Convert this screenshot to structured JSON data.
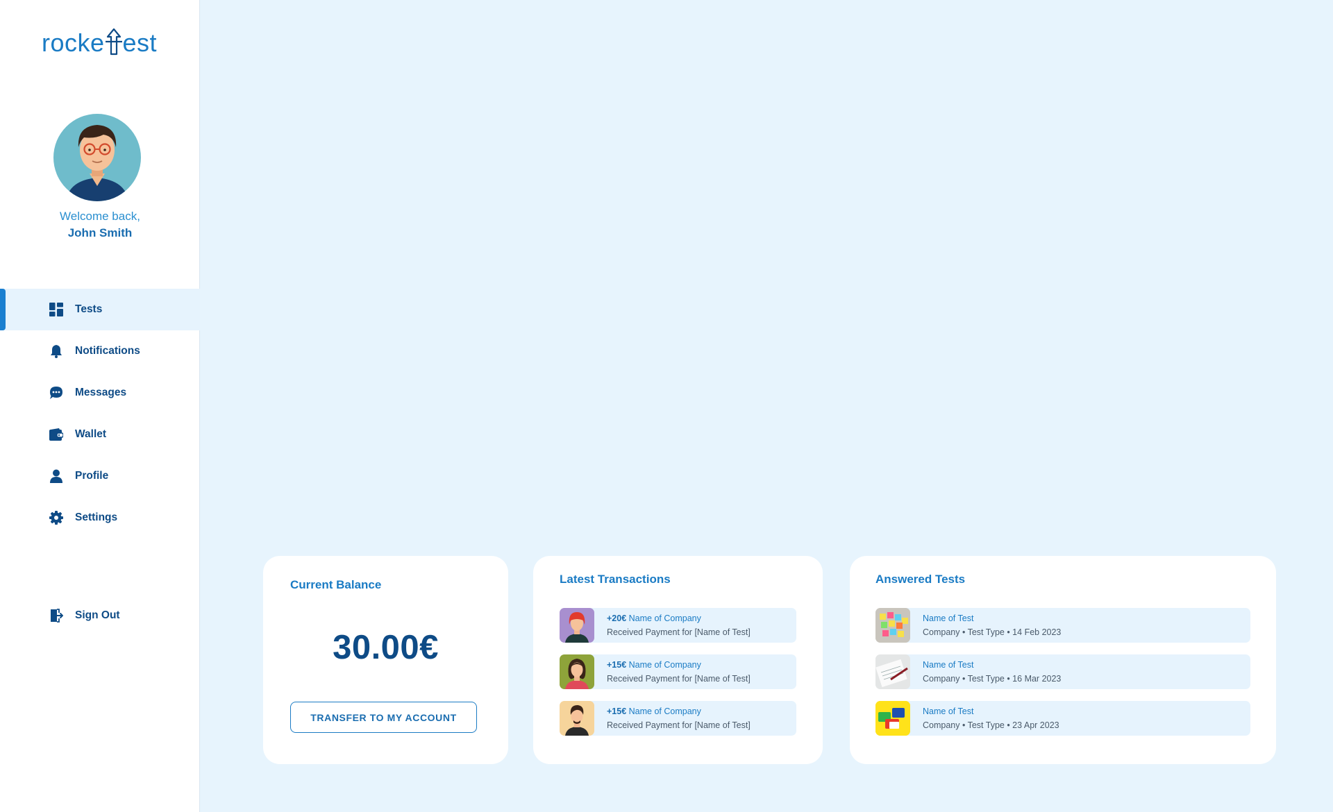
{
  "app": {
    "logo_text_left": "rocke",
    "logo_text_right": "est",
    "logo_mark": "arrow-t-icon"
  },
  "user": {
    "welcome": "Welcome back,",
    "name": "John Smith",
    "avatar_icon": "user-avatar"
  },
  "nav": {
    "items": [
      {
        "label": "Tests",
        "icon": "dashboard-icon",
        "active": true
      },
      {
        "label": "Notifications",
        "icon": "bell-icon"
      },
      {
        "label": "Messages",
        "icon": "chat-icon"
      },
      {
        "label": "Wallet",
        "icon": "wallet-icon"
      },
      {
        "label": "Profile",
        "icon": "person-icon"
      },
      {
        "label": "Settings",
        "icon": "gear-icon"
      }
    ],
    "sign_out": "Sign Out"
  },
  "balance": {
    "title": "Current Balance",
    "amount": "30.00€",
    "transfer_label": "TRANSFER TO MY ACCOUNT"
  },
  "transactions": {
    "title": "Latest Transactions",
    "items": [
      {
        "amount": "+20€",
        "company": "Name of Company",
        "desc": "Received Payment for [Name of Test]",
        "avatar_bg": "#a88fcf"
      },
      {
        "amount": "+15€",
        "company": "Name of Company",
        "desc": "Received Payment for [Name of Test]",
        "avatar_bg": "#8ea33a"
      },
      {
        "amount": "+15€",
        "company": "Name of Company",
        "desc": "Received Payment for [Name of Test]",
        "avatar_bg": "#f6d49b"
      }
    ]
  },
  "answered_tests": {
    "title": "Answered Tests",
    "items": [
      {
        "name": "Name of Test",
        "meta": "Company • Test Type • 14 Feb 2023",
        "thumb": "sticky-notes-image"
      },
      {
        "name": "Name of Test",
        "meta": "Company • Test Type • 16 Mar 2023",
        "thumb": "paper-pen-image"
      },
      {
        "name": "Name of Test",
        "meta": "Company • Test Type • 23 Apr 2023",
        "thumb": "speech-bubbles-image"
      }
    ]
  },
  "colors": {
    "primary": "#1a7bc4",
    "dark": "#0e4b86",
    "background": "#e7f4fd",
    "row_bg": "#e6f3fd"
  }
}
